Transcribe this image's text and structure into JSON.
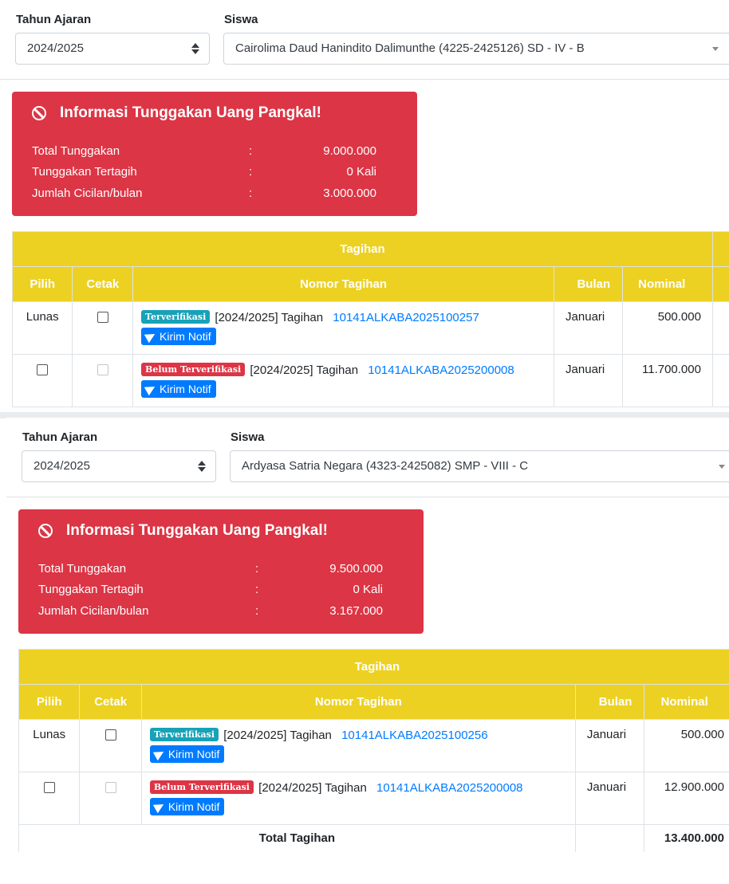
{
  "panels": [
    {
      "tahun_ajaran": {
        "label": "Tahun Ajaran",
        "value": "2024/2025"
      },
      "siswa": {
        "label": "Siswa",
        "value": "Cairolima Daud Hanindito Dalimunthe (4225-2425126) SD - IV - B"
      },
      "alert": {
        "title": "Informasi Tunggakan Uang Pangkal!",
        "rows": [
          {
            "label": "Total Tunggakan",
            "colon": ":",
            "value": "9.000.000"
          },
          {
            "label": "Tunggakan Tertagih",
            "colon": ":",
            "value": "0 Kali"
          },
          {
            "label": "Jumlah Cicilan/bulan",
            "colon": ":",
            "value": "3.000.000"
          }
        ]
      },
      "table": {
        "group_header": "Tagihan",
        "headers": {
          "pilih": "Pilih",
          "cetak": "Cetak",
          "nomor": "Nomor Tagihan",
          "bulan": "Bulan",
          "nominal": "Nominal"
        },
        "rows": [
          {
            "pilih": "Lunas",
            "badge": "Terverifikasi",
            "text": "[2024/2025] Tagihan",
            "ref": "10141ALKABA2025100257",
            "button": "Kirim Notif",
            "bulan": "Januari",
            "nominal": "500.000"
          },
          {
            "pilih": "",
            "badge": "Belum Terverifikasi",
            "text": "[2024/2025] Tagihan",
            "ref": "10141ALKABA2025200008",
            "button": "Kirim Notif",
            "bulan": "Januari",
            "nominal": "11.700.000"
          }
        ]
      }
    },
    {
      "tahun_ajaran": {
        "label": "Tahun Ajaran",
        "value": "2024/2025"
      },
      "siswa": {
        "label": "Siswa",
        "value": "Ardyasa Satria Negara (4323-2425082) SMP - VIII - C"
      },
      "alert": {
        "title": "Informasi Tunggakan Uang Pangkal!",
        "rows": [
          {
            "label": "Total Tunggakan",
            "colon": ":",
            "value": "9.500.000"
          },
          {
            "label": "Tunggakan Tertagih",
            "colon": ":",
            "value": "0 Kali"
          },
          {
            "label": "Jumlah Cicilan/bulan",
            "colon": ":",
            "value": "3.167.000"
          }
        ]
      },
      "table": {
        "group_header": "Tagihan",
        "headers": {
          "pilih": "Pilih",
          "cetak": "Cetak",
          "nomor": "Nomor Tagihan",
          "bulan": "Bulan",
          "nominal": "Nominal"
        },
        "rows": [
          {
            "pilih": "Lunas",
            "badge": "Terverifikasi",
            "text": "[2024/2025] Tagihan",
            "ref": "10141ALKABA2025100256",
            "button": "Kirim Notif",
            "bulan": "Januari",
            "nominal": "500.000"
          },
          {
            "pilih": "",
            "badge": "Belum Terverifikasi",
            "text": "[2024/2025] Tagihan",
            "ref": "10141ALKABA2025200008",
            "button": "Kirim Notif",
            "bulan": "Januari",
            "nominal": "12.900.000"
          }
        ],
        "total": {
          "label": "Total Tagihan",
          "value": "13.400.000"
        }
      }
    }
  ]
}
